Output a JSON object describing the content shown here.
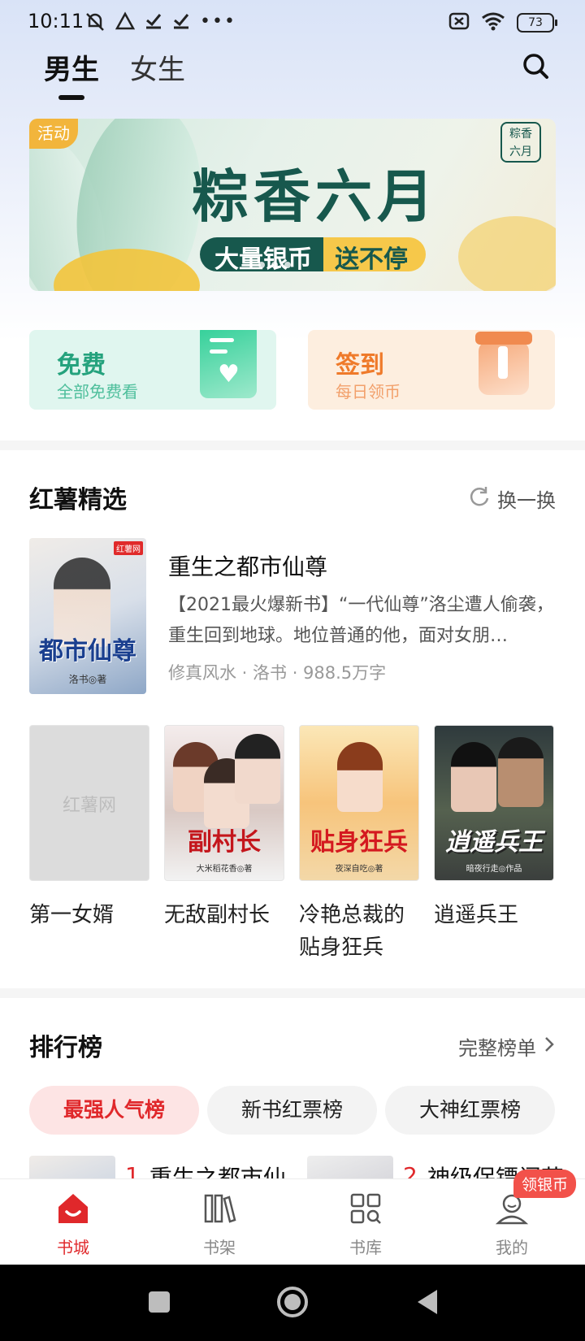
{
  "status_bar": {
    "time": "10:11",
    "battery": "73"
  },
  "gender_tabs": [
    {
      "label": "男生",
      "active": true
    },
    {
      "label": "女生",
      "active": false
    }
  ],
  "banner": {
    "tag": "活动",
    "title": "粽香六月",
    "sub_left": "大量银币",
    "sub_right": "送不停",
    "logo_text": "粽香六月"
  },
  "quick_cards": {
    "free": {
      "title": "免费",
      "subtitle": "全部免费看"
    },
    "sign": {
      "title": "签到",
      "subtitle": "每日领币"
    }
  },
  "featured_section": {
    "title": "红薯精选",
    "refresh_label": "换一换",
    "main_book": {
      "title": "重生之都市仙尊",
      "description": "【2021最火爆新书】“一代仙尊”洛尘遭人偷袭，重生回到地球。地位普通的他，面对女朋…",
      "meta": "修真风水 · 洛书 · 988.5万字",
      "cover_title": "都市仙尊",
      "cover_author": "洛书◎著",
      "cover_badge": "红薯网"
    },
    "grid_books": [
      {
        "name": "第一女婿",
        "cover_text": "红薯网",
        "cover_small": ""
      },
      {
        "name": "无敌副村长",
        "cover_text": "副村长",
        "cover_small": "大米稻花香◎著"
      },
      {
        "name": "冷艳总裁的贴身狂兵",
        "cover_text": "贴身狂兵",
        "cover_small": "夜深自吃◎著"
      },
      {
        "name": "逍遥兵王",
        "cover_text": "逍遥兵王",
        "cover_small": "暗夜行走◎作品"
      }
    ]
  },
  "ranking_section": {
    "title": "排行榜",
    "full_list_label": "完整榜单",
    "tabs": [
      {
        "label": "最强人气榜",
        "active": true
      },
      {
        "label": "新书红票榜",
        "active": false
      },
      {
        "label": "大神红票榜",
        "active": false
      }
    ],
    "items": [
      {
        "rank": "1",
        "name": "重生之都市仙"
      },
      {
        "rank": "2",
        "name": "神级保镖闯花"
      }
    ]
  },
  "bottom_nav": {
    "items": [
      {
        "label": "书城",
        "icon": "home-icon",
        "active": true
      },
      {
        "label": "书架",
        "icon": "bookshelf-icon",
        "active": false
      },
      {
        "label": "书库",
        "icon": "library-icon",
        "active": false
      },
      {
        "label": "我的",
        "icon": "profile-icon",
        "active": false
      }
    ],
    "badge": "领银币"
  },
  "colors": {
    "accent": "#e0282b",
    "free": "#25a27d",
    "sign": "#ef7a2a",
    "banner_green": "#17584d"
  }
}
